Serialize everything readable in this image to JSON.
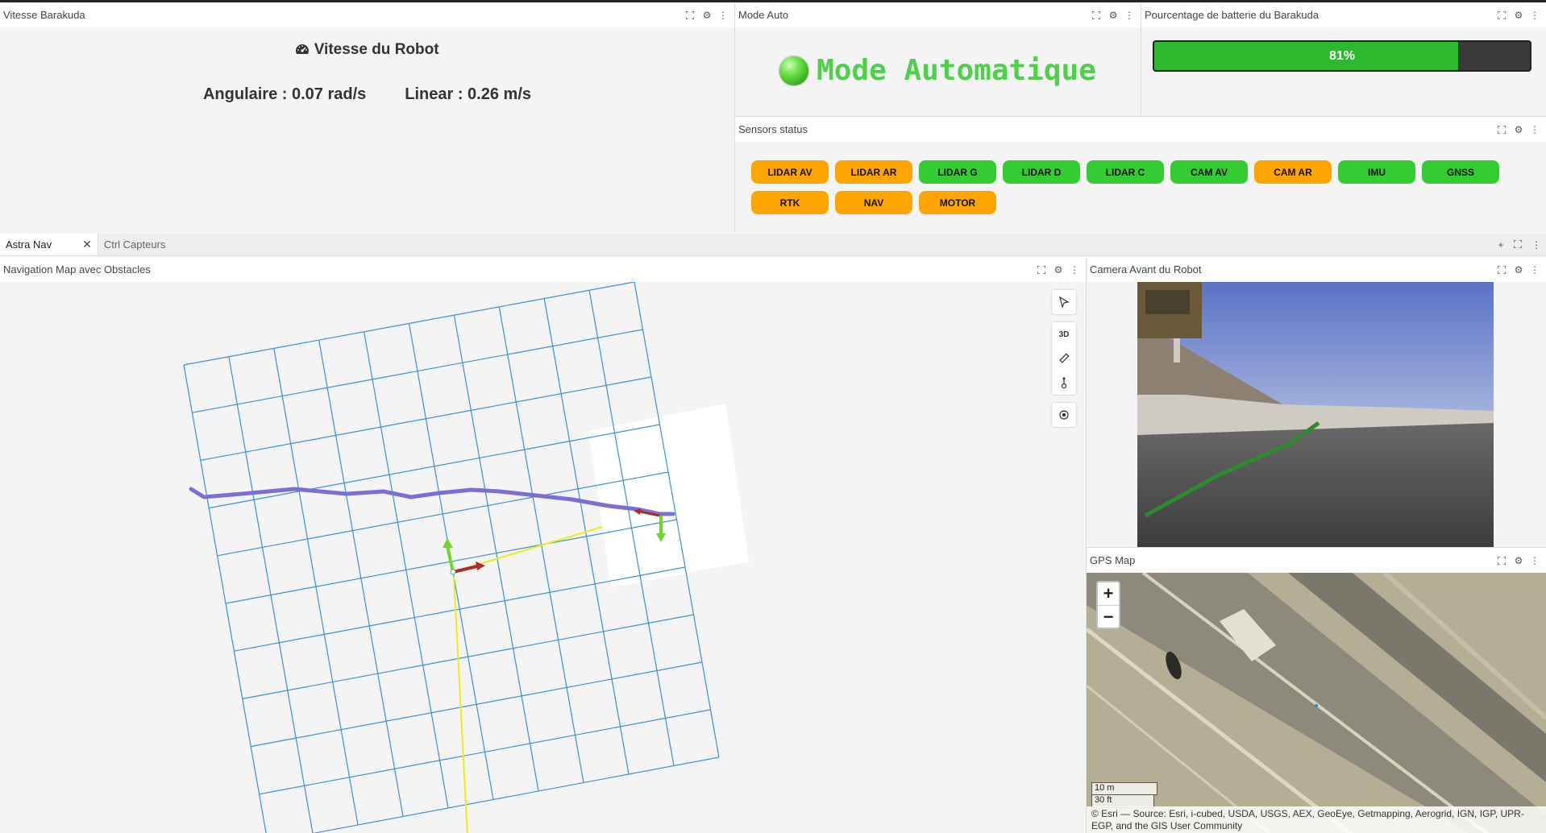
{
  "vitesse_panel": {
    "header_title": "Vitesse Barakuda",
    "title": "Vitesse du Robot",
    "angular": "Angulaire : 0.07 rad/s",
    "linear": "Linear : 0.26 m/s"
  },
  "mode_panel": {
    "header_title": "Mode Auto",
    "mode_text": "Mode Automatique",
    "indicator_color": "#4fd04a"
  },
  "battery_panel": {
    "header_title": "Pourcentage de batterie du Barakuda",
    "level": 0.81,
    "label": "81%",
    "fill_color": "#2eb82e"
  },
  "sensors_panel": {
    "header_title": "Sensors status",
    "sensors": [
      {
        "label": "LIDAR AV",
        "status": "warning"
      },
      {
        "label": "LIDAR AR",
        "status": "warning"
      },
      {
        "label": "LIDAR G",
        "status": "ok"
      },
      {
        "label": "LIDAR D",
        "status": "ok"
      },
      {
        "label": "LIDAR C",
        "status": "ok"
      },
      {
        "label": "CAM AV",
        "status": "ok"
      },
      {
        "label": "CAM AR",
        "status": "warning"
      },
      {
        "label": "IMU",
        "status": "ok"
      },
      {
        "label": "GNSS",
        "status": "ok"
      },
      {
        "label": "RTK",
        "status": "warning"
      },
      {
        "label": "NAV",
        "status": "warning"
      },
      {
        "label": "MOTOR",
        "status": "warning"
      }
    ],
    "ok_color": "#33cc33",
    "warning_color": "#ffa500"
  },
  "tabs": {
    "items": [
      {
        "label": "Astra Nav",
        "active": true
      },
      {
        "label": "Ctrl Capteurs",
        "active": false
      }
    ]
  },
  "nav_map": {
    "header_title": "Navigation Map avec Obstacles",
    "toolbar": {
      "select_icon": "cursor-arrow-icon",
      "view_3d_label": "3D",
      "measure_icon": "ruler-icon",
      "publish_point_icon": "pin-icon",
      "center_icon": "target-icon"
    },
    "grid_color": "#3a8fe0",
    "path_color": "#7b6fd6"
  },
  "camera_panel": {
    "header_title": "Camera Avant du Robot"
  },
  "gps_panel": {
    "header_title": "GPS Map",
    "zoom_in": "+",
    "zoom_out": "−",
    "scale_metric": "10 m",
    "scale_imperial": "30 ft",
    "attribution": "© Esri — Source: Esri, i-cubed, USDA, USGS, AEX, GeoEye, Getmapping, Aerogrid, IGN, IGP, UPR-EGP, and the GIS User Community"
  }
}
